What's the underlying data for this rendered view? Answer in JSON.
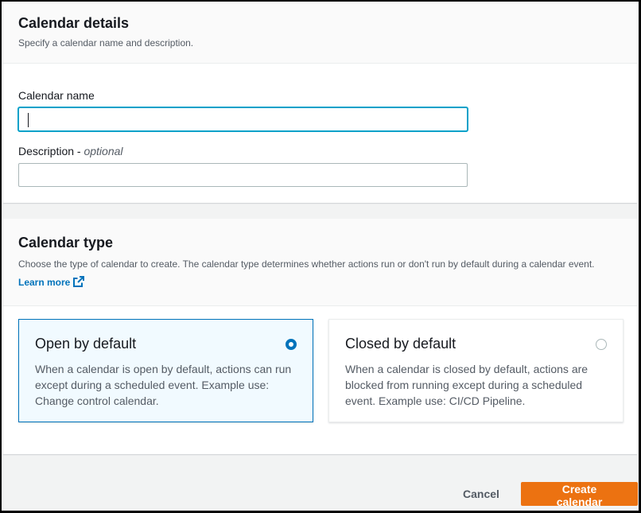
{
  "details": {
    "title": "Calendar details",
    "subtitle": "Specify a calendar name and description.",
    "name_label": "Calendar name",
    "name_value": "",
    "description_label": "Description - ",
    "description_optional": "optional",
    "description_value": ""
  },
  "type": {
    "title": "Calendar type",
    "description": "Choose the type of calendar to create. The calendar type determines whether actions run or don't run by default during a calendar event.",
    "learn_more": "Learn more",
    "options": [
      {
        "label": "Open by default",
        "description": "When a calendar is open by default, actions can run except during a scheduled event. Example use: Change control calendar.",
        "selected": true
      },
      {
        "label": "Closed by default",
        "description": "When a calendar is closed by default, actions are blocked from running except during a scheduled event. Example use: CI/CD Pipeline.",
        "selected": false
      }
    ]
  },
  "actions": {
    "cancel_label": "Cancel",
    "create_label": "Create calendar"
  },
  "colors": {
    "accent": "#0073bb",
    "primary_button": "#ec7211",
    "focus_ring": "#00a1c9"
  }
}
